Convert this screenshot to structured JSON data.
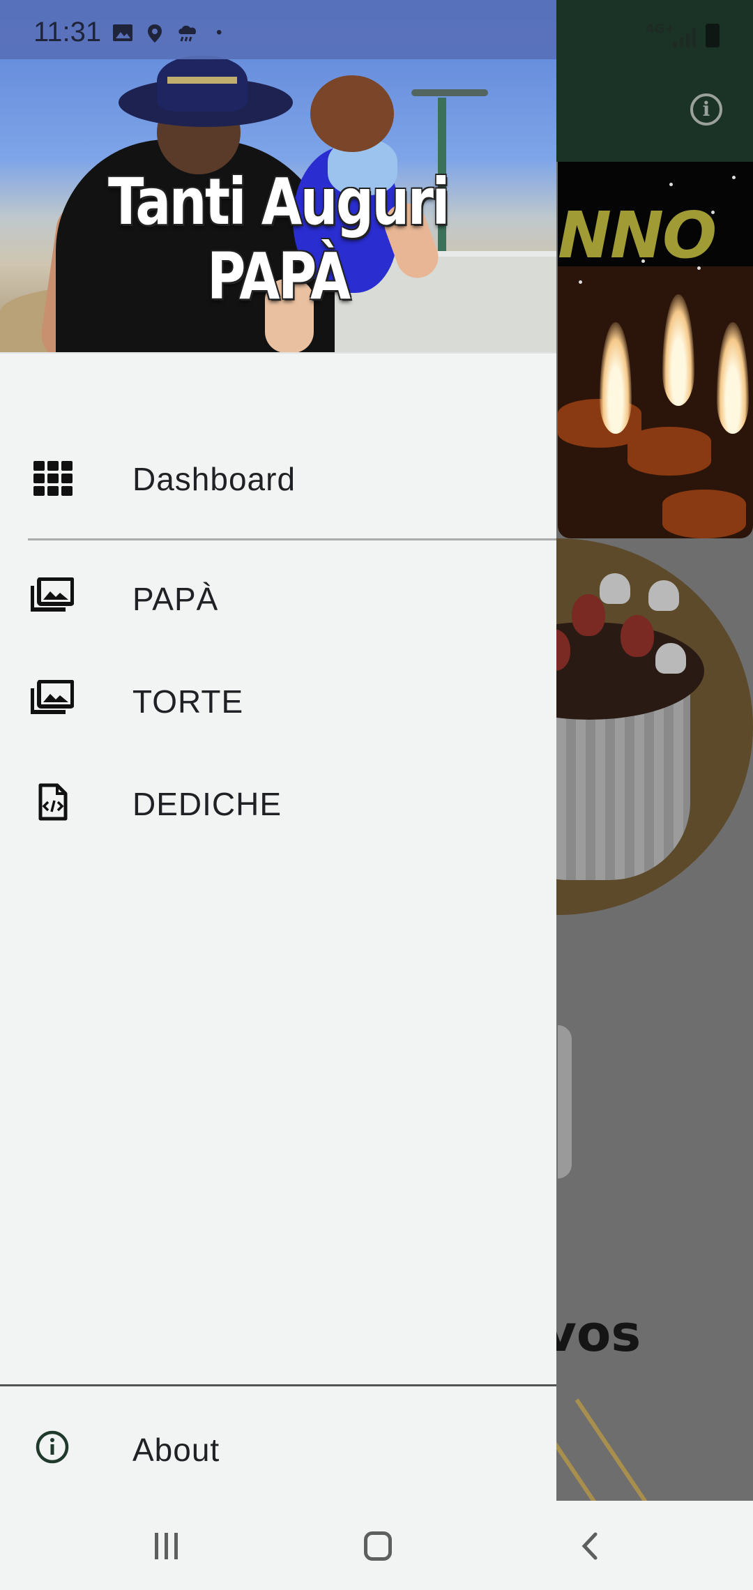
{
  "status_bar": {
    "time": "11:31",
    "network": "4G+"
  },
  "drawer": {
    "header_title": "Tanti Auguri PAPÀ",
    "menu": [
      {
        "label": "Dashboard",
        "icon": "grid-icon"
      },
      {
        "label": "PAPÀ",
        "icon": "photo-library-icon"
      },
      {
        "label": "TORTE",
        "icon": "photo-library-icon"
      },
      {
        "label": "DEDICHE",
        "icon": "code-file-icon"
      }
    ],
    "footer_item": {
      "label": "About",
      "icon": "info-icon"
    }
  },
  "background_app": {
    "card_text_1": "NNO",
    "card_text_2": "vos",
    "toolbar_icon": "info-icon",
    "toolbar_color": "#1a3326"
  },
  "colors": {
    "status_bar_tint": "#5870b8",
    "drawer_bg": "#f1f4f3",
    "text_primary": "#202124"
  },
  "nav_bar": {
    "buttons": [
      "recents-icon",
      "home-icon",
      "back-icon"
    ]
  }
}
